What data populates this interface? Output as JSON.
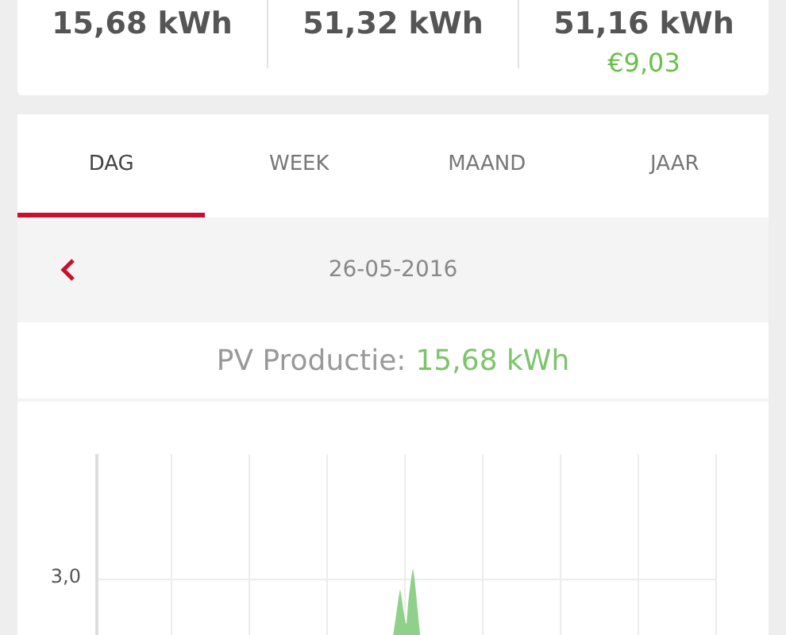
{
  "summary": [
    {
      "value": "15,68 kWh"
    },
    {
      "value": "51,32 kWh"
    },
    {
      "value": "51,16 kWh",
      "cost": "€9,03"
    }
  ],
  "tabs": [
    {
      "label": "DAG",
      "selected": true
    },
    {
      "label": "WEEK",
      "selected": false
    },
    {
      "label": "MAAND",
      "selected": false
    },
    {
      "label": "JAAR",
      "selected": false
    }
  ],
  "date_bar": {
    "date": "26-05-2016"
  },
  "production": {
    "label": "PV Productie:",
    "value": "15,68 kWh"
  },
  "chart": {
    "y_tick_label": "3,0"
  }
}
